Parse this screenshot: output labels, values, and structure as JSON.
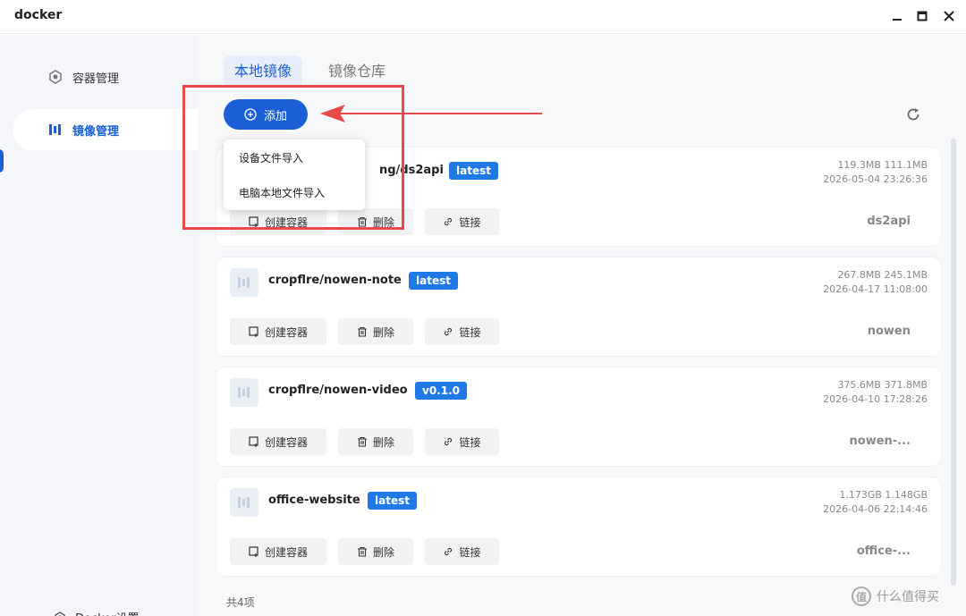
{
  "window": {
    "title": "docker"
  },
  "sidebar": {
    "items": [
      {
        "label": "容器管理",
        "icon": "hexagon-icon"
      },
      {
        "label": "镜像管理",
        "icon": "image-icon"
      }
    ],
    "settings_label": "Docker设置"
  },
  "tabs": [
    {
      "label": "本地镜像"
    },
    {
      "label": "镜像仓库"
    }
  ],
  "toolbar": {
    "add_label": "添加"
  },
  "dropdown": {
    "items": [
      {
        "label": "设备文件导入"
      },
      {
        "label": "电脑本地文件导入"
      }
    ]
  },
  "actions": {
    "create_label": "创建容器",
    "delete_label": "删除",
    "link_label": "链接"
  },
  "images": [
    {
      "name": "ng/ds2api",
      "tag": "latest",
      "size": "119.3MB 111.1MB",
      "date": "2026-05-04 23:26:36",
      "short_name": "ds2api"
    },
    {
      "name": "cropflre/nowen-note",
      "tag": "latest",
      "size": "267.8MB 245.1MB",
      "date": "2026-04-17 11:08:00",
      "short_name": "nowen"
    },
    {
      "name": "cropflre/nowen-video",
      "tag": "v0.1.0",
      "size": "375.6MB 371.8MB",
      "date": "2026-04-10 17:28:26",
      "short_name": "nowen-..."
    },
    {
      "name": "office-website",
      "tag": "latest",
      "size": "1.173GB 1.148GB",
      "date": "2026-04-06 22:14:46",
      "short_name": "office-..."
    }
  ],
  "footer": {
    "count": "共4项"
  },
  "colors": {
    "accent": "#1a5fd6",
    "tag": "#1f7ae8",
    "annotation": "#e84a4a"
  },
  "watermark": {
    "text": "什么值得买"
  }
}
